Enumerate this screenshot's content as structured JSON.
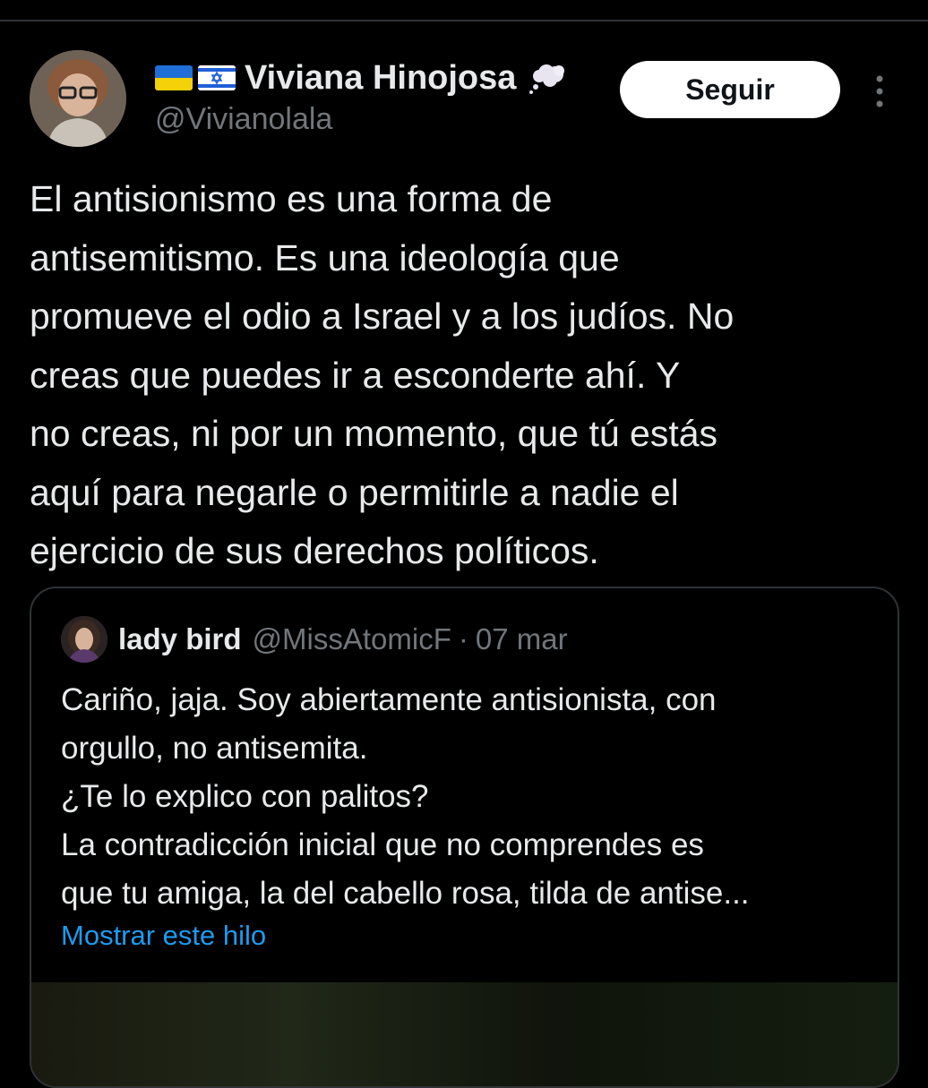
{
  "author": {
    "flags": [
      "ukraine-flag",
      "israel-flag"
    ],
    "display_name": "Viviana Hinojosa",
    "handle": "@Vivianolala",
    "badge_icon": "thought-bubble-icon"
  },
  "actions": {
    "follow_label": "Seguir",
    "more_icon": "more-vertical-icon"
  },
  "tweet": {
    "lines": [
      "El antisionismo es una forma de",
      "antisemitismo. Es una ideología que",
      "promueve el odio a Israel y a los judíos. No",
      "creas que puedes ir a esconderte ahí. Y",
      "no creas, ni por un momento, que tú estás",
      "aquí para negarle o permitirle a nadie el",
      "ejercicio de sus derechos políticos."
    ]
  },
  "quote": {
    "display_name": "lady bird",
    "handle": "@MissAtomicF",
    "separator": "·",
    "date": "07 mar",
    "lines": [
      "Cariño, jaja. Soy abiertamente antisionista, con",
      "orgullo, no antisemita.",
      "¿Te lo explico con palitos?",
      "La contradicción inicial que no comprendes es",
      "que tu amiga, la del cabello rosa, tilda de antise..."
    ],
    "show_thread_label": "Mostrar este hilo"
  },
  "colors": {
    "background": "#000000",
    "text_primary": "#e7e9ea",
    "text_secondary": "#71767b",
    "link": "#1d9bf0",
    "border": "#2f3336",
    "button_bg": "#ffffff"
  }
}
